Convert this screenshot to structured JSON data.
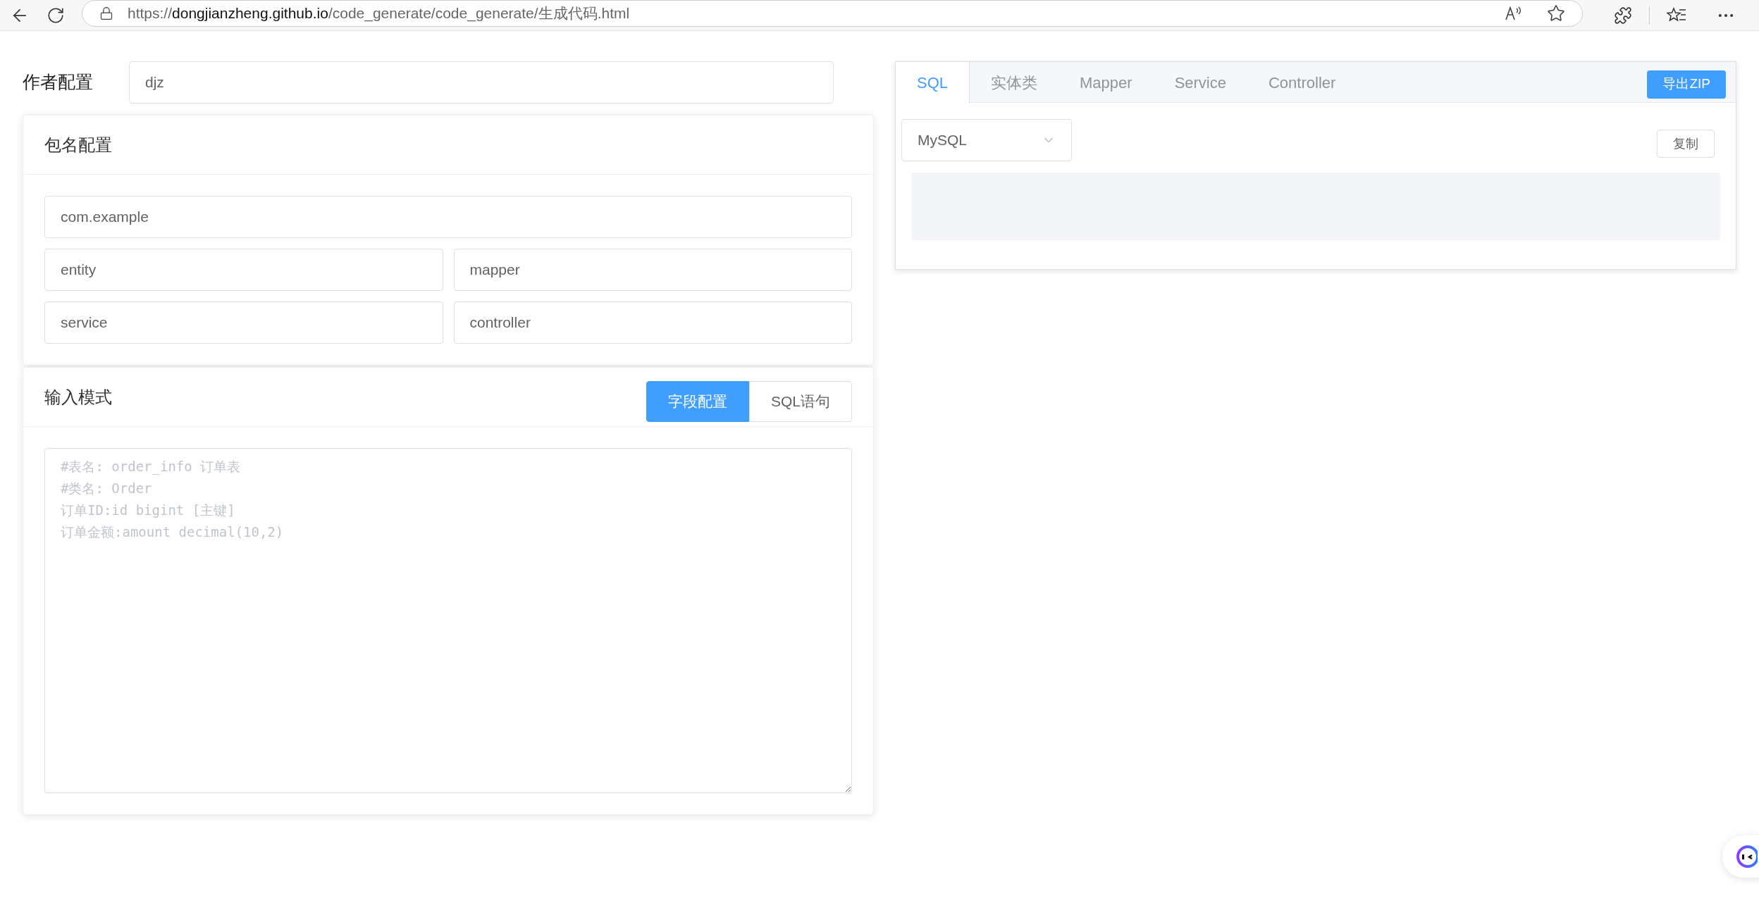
{
  "browser": {
    "url": {
      "scheme": "https://",
      "host": "dongjianzheng.github.io",
      "path": "/code_generate/code_generate/生成代码.html"
    }
  },
  "author": {
    "label": "作者配置",
    "value": "djz"
  },
  "package_config": {
    "title": "包名配置",
    "base": "com.example",
    "fields": [
      "entity",
      "mapper",
      "service",
      "controller"
    ]
  },
  "input_mode": {
    "title": "输入模式",
    "modes": [
      {
        "label": "字段配置",
        "selected": true
      },
      {
        "label": "SQL语句",
        "selected": false
      }
    ],
    "placeholder": "#表名: order_info 订单表\n#类名: Order\n订单ID:id bigint [主键]\n订单金额:amount decimal(10,2)"
  },
  "output": {
    "tabs": [
      {
        "label": "SQL",
        "selected": true
      },
      {
        "label": "实体类",
        "selected": false
      },
      {
        "label": "Mapper",
        "selected": false
      },
      {
        "label": "Service",
        "selected": false
      },
      {
        "label": "Controller",
        "selected": false
      }
    ],
    "export_button": "导出ZIP",
    "database": "MySQL",
    "copy_button": "复制"
  }
}
